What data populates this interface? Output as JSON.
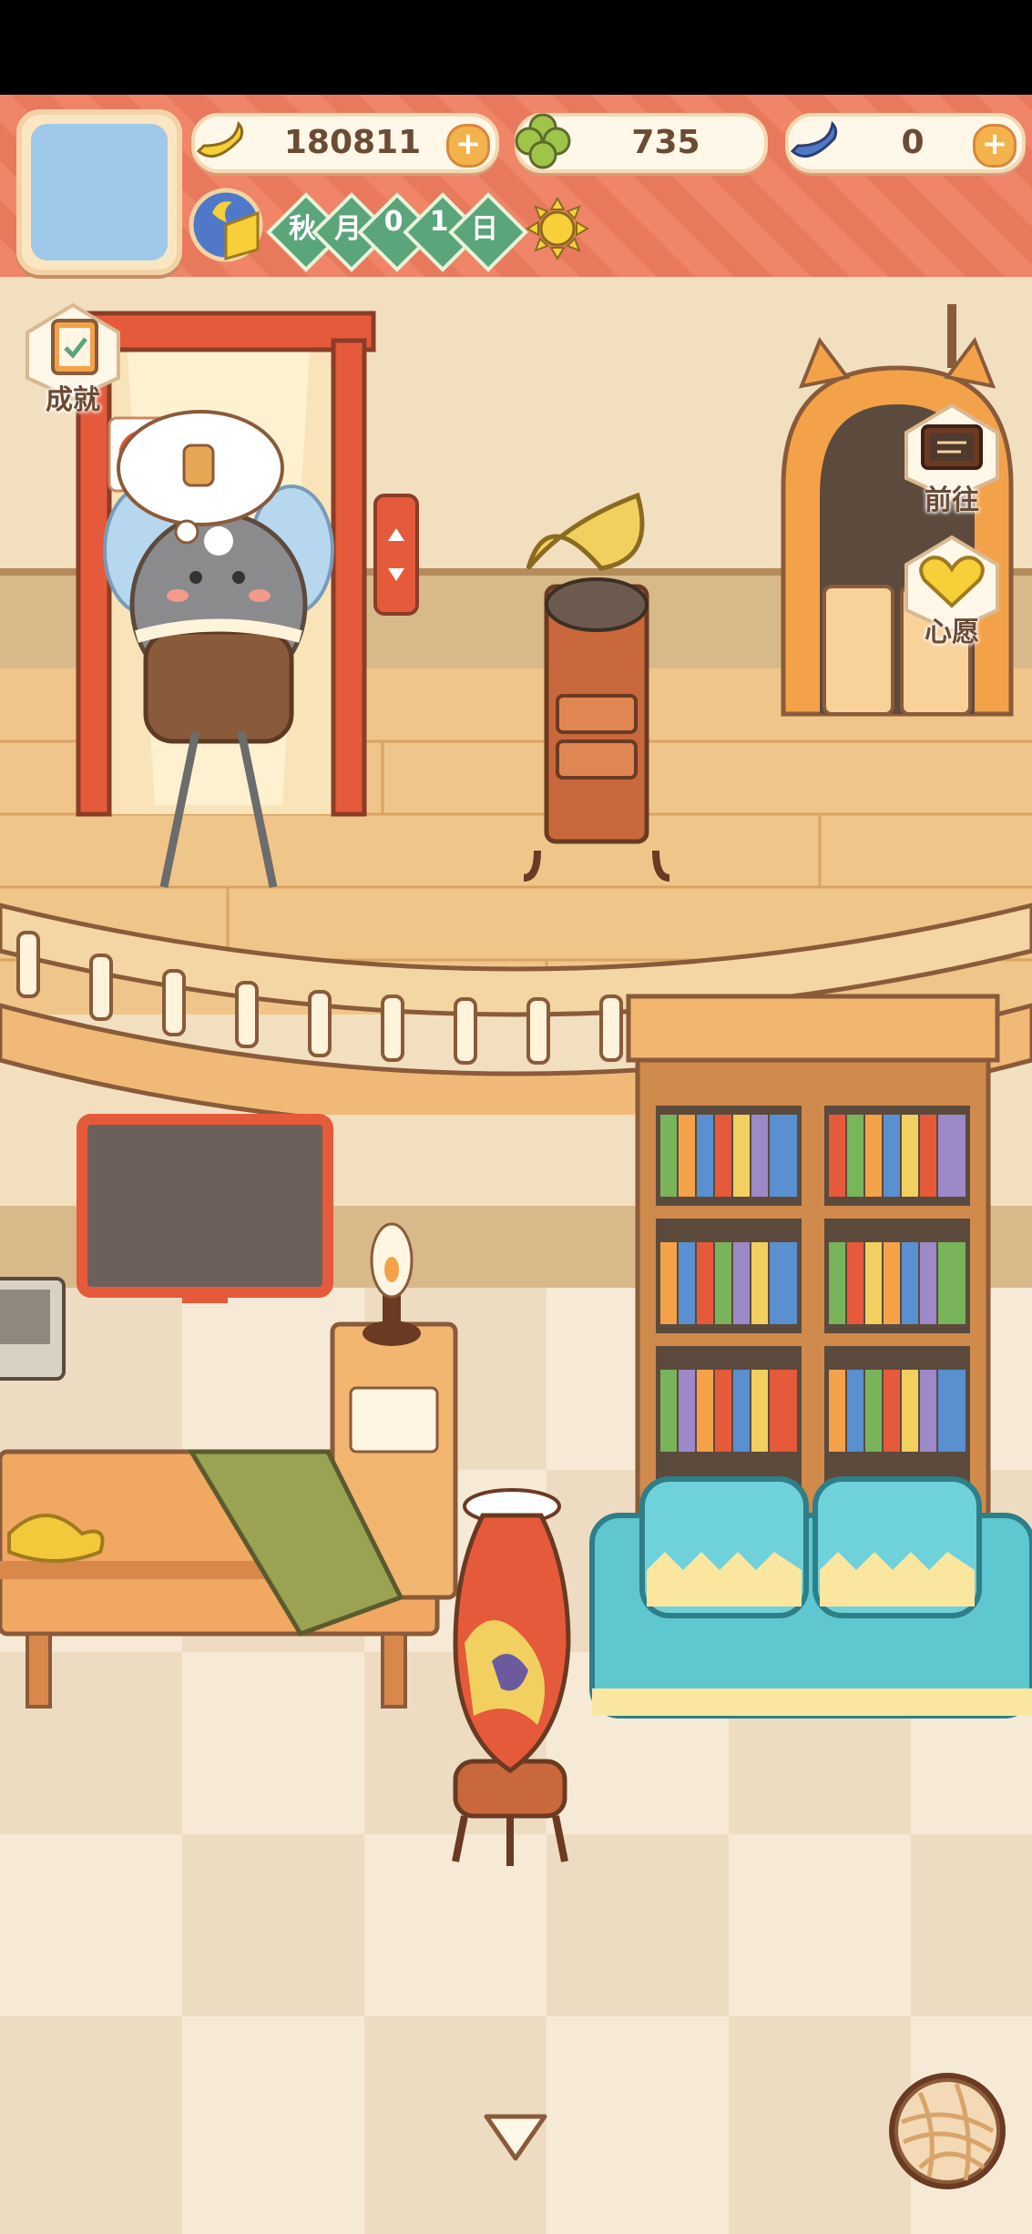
{
  "currencies": {
    "banana": {
      "icon": "banana-icon",
      "value": "180811"
    },
    "clover": {
      "icon": "clover-icon",
      "value": "735"
    },
    "blue_banana": {
      "icon": "blue-banana-icon",
      "value": "0"
    }
  },
  "plus_label": "+",
  "calendar": {
    "season": "秋",
    "month_char": "月",
    "day_digits": [
      "0",
      "1"
    ],
    "day_char": "日",
    "weather_icon": "sun-icon"
  },
  "buttons": {
    "achievements": "成就",
    "go": "前往",
    "wish": "心愿"
  },
  "colors": {
    "curtain": "#ef7d5f",
    "wall": "#f2dfc0",
    "floor_wood": "#f0c58a",
    "tile_light": "#f6ead6",
    "tile_dark": "#eedcc2",
    "sofa": "#5fc7d0",
    "accent_green": "#5aa57a"
  }
}
